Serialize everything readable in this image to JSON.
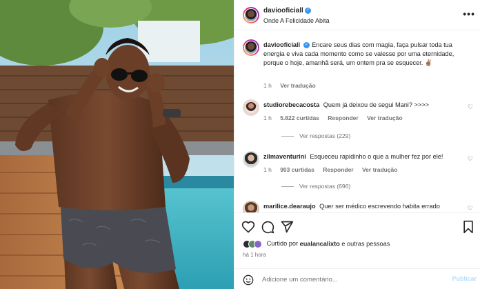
{
  "post": {
    "username": "daviooficiall",
    "location": "Onde A Felicidade Abita",
    "caption": "Encare seus dias com magia, faça pulsar toda tua energia e viva cada momento como se valesse por uma eternidade, porque o hoje, amanhã será, um ontem pra se esquecer. ✌🏽",
    "caption_time": "1 h",
    "see_translation": "Ver tradução",
    "more_icon": "more-horizontal-icon"
  },
  "comments": [
    {
      "username": "studiorebecacosta",
      "text": "Quem já deixou de segui Mani? >>>>",
      "time": "1 h",
      "likes": "5.822 curtidas",
      "reply": "Responder",
      "translate": "Ver tradução",
      "replies_label": "Ver respostas (229)"
    },
    {
      "username": "zilmaventurini",
      "text": "Esqueceu rapidinho o que a mulher fez por ele!",
      "time": "1 h",
      "likes": "903 curtidas",
      "reply": "Responder",
      "translate": "Ver tradução",
      "replies_label": "Ver respostas (696)"
    },
    {
      "username": "marilice.dearaujo",
      "text": "Quer ser médico escrevendo habita errado"
    }
  ],
  "footer": {
    "liked_prefix": "Curtido por",
    "liked_user": "eualancalixto",
    "liked_suffix": "e outras pessoas",
    "time_ago": "há 1 hora",
    "comment_placeholder": "Adicione um comentário...",
    "publish": "Publicar"
  },
  "colors": {
    "verified": "#3897f0",
    "muted": "#737373",
    "publish_disabled": "#b2dffc"
  }
}
